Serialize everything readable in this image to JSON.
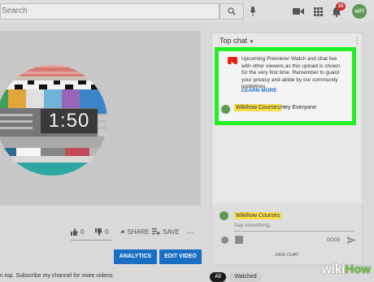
{
  "header": {
    "search_placeholder": "Search",
    "notification_count": "15",
    "avatar_initials": "wH"
  },
  "player": {
    "countdown": "1:50"
  },
  "actions": {
    "like_count": "0",
    "dislike_count": "0",
    "share_label": "SHARE",
    "save_label": "SAVE",
    "more_label": "...",
    "analytics_label": "ANALYTICS",
    "edit_label": "EDIT VIDEO"
  },
  "description": {
    "text": "n top. Subscribe my channel for more videos:"
  },
  "chat": {
    "header_label": "Top chat",
    "more_label": "⋮",
    "notice": "Upcoming Premiere! Watch and chat live with other viewers as this upload is shown for the very first time. Remember to guard your privacy and abide by our community guidelines.",
    "learn_more": "LEARN MORE",
    "messages": [
      {
        "author": "Wikihow Courses",
        "text": "Hey Everyone"
      }
    ],
    "composer_author": "Wikihow Courses",
    "input_placeholder": "Say something...",
    "char_count": "0/200",
    "hide_label": "HIDE CHAT"
  },
  "filters": {
    "all_label": "All",
    "watched_label": "Watched"
  },
  "watermark": {
    "part1": "wiki",
    "part2": "How"
  },
  "colors": {
    "accent_blue": "#1a6fc4",
    "highlight_green": "#22f024",
    "author_badge": "#f7dc4b",
    "yt_red": "#e62117"
  }
}
